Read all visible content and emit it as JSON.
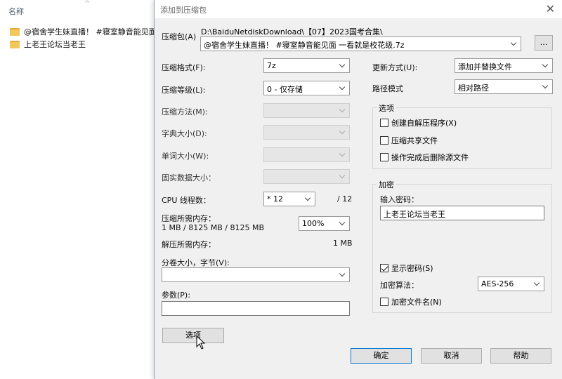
{
  "explorer": {
    "column_header": "名称",
    "files": [
      {
        "name": "@宿舍学生妹直播！ #寝室静音能见面"
      },
      {
        "name": "上老王论坛当老王"
      }
    ]
  },
  "dialog": {
    "title": "添加到压缩包",
    "archive_label": "压缩包(A)",
    "archive_path": "D:\\BaiduNetdiskDownload\\【07】2023国考合集\\",
    "archive_name": "@宿舍学生妹直播！ #寝室静音能见面 一看就是校花级.7z",
    "browse_label": "...",
    "left": {
      "format_label": "压缩格式(F):",
      "format_value": "7z",
      "level_label": "压缩等级(L):",
      "level_value": "0 - 仅存储",
      "method_label": "压缩方法(M):",
      "dict_label": "字典大小(D):",
      "word_label": "单词大小(W):",
      "solid_label": "固实数据大小：",
      "threads_label": "CPU 线程数：",
      "threads_value": "* 12",
      "threads_total": "/ 12",
      "mem_compress_label": "压缩所需内存：",
      "mem_compress_value": "1 MB / 8125 MB / 8125 MB",
      "mem_percent": "100%",
      "mem_decompress_label": "解压所需内存：",
      "mem_decompress_value": "1 MB",
      "split_label": "分卷大小，字节(V):",
      "split_value": "",
      "params_label": "参数(P):",
      "params_value": "",
      "options_button": "选项"
    },
    "right": {
      "update_label": "更新方式(U):",
      "update_value": "添加并替换文件",
      "path_label": "路径模式",
      "path_value": "相对路径",
      "options_group": "选项",
      "opt_sfx": "创建自解压程序(X)",
      "opt_shared": "压缩共享文件",
      "opt_delete": "操作完成后删除源文件",
      "encrypt_group": "加密",
      "password_label": "输入密码：",
      "password_value": "上老王论坛当老王",
      "show_password": "显示密码(S)",
      "method_label": "加密算法：",
      "method_value": "AES-256",
      "encrypt_names": "加密文件名(N)"
    },
    "buttons": {
      "ok": "确定",
      "cancel": "取消",
      "help": "帮助"
    }
  }
}
